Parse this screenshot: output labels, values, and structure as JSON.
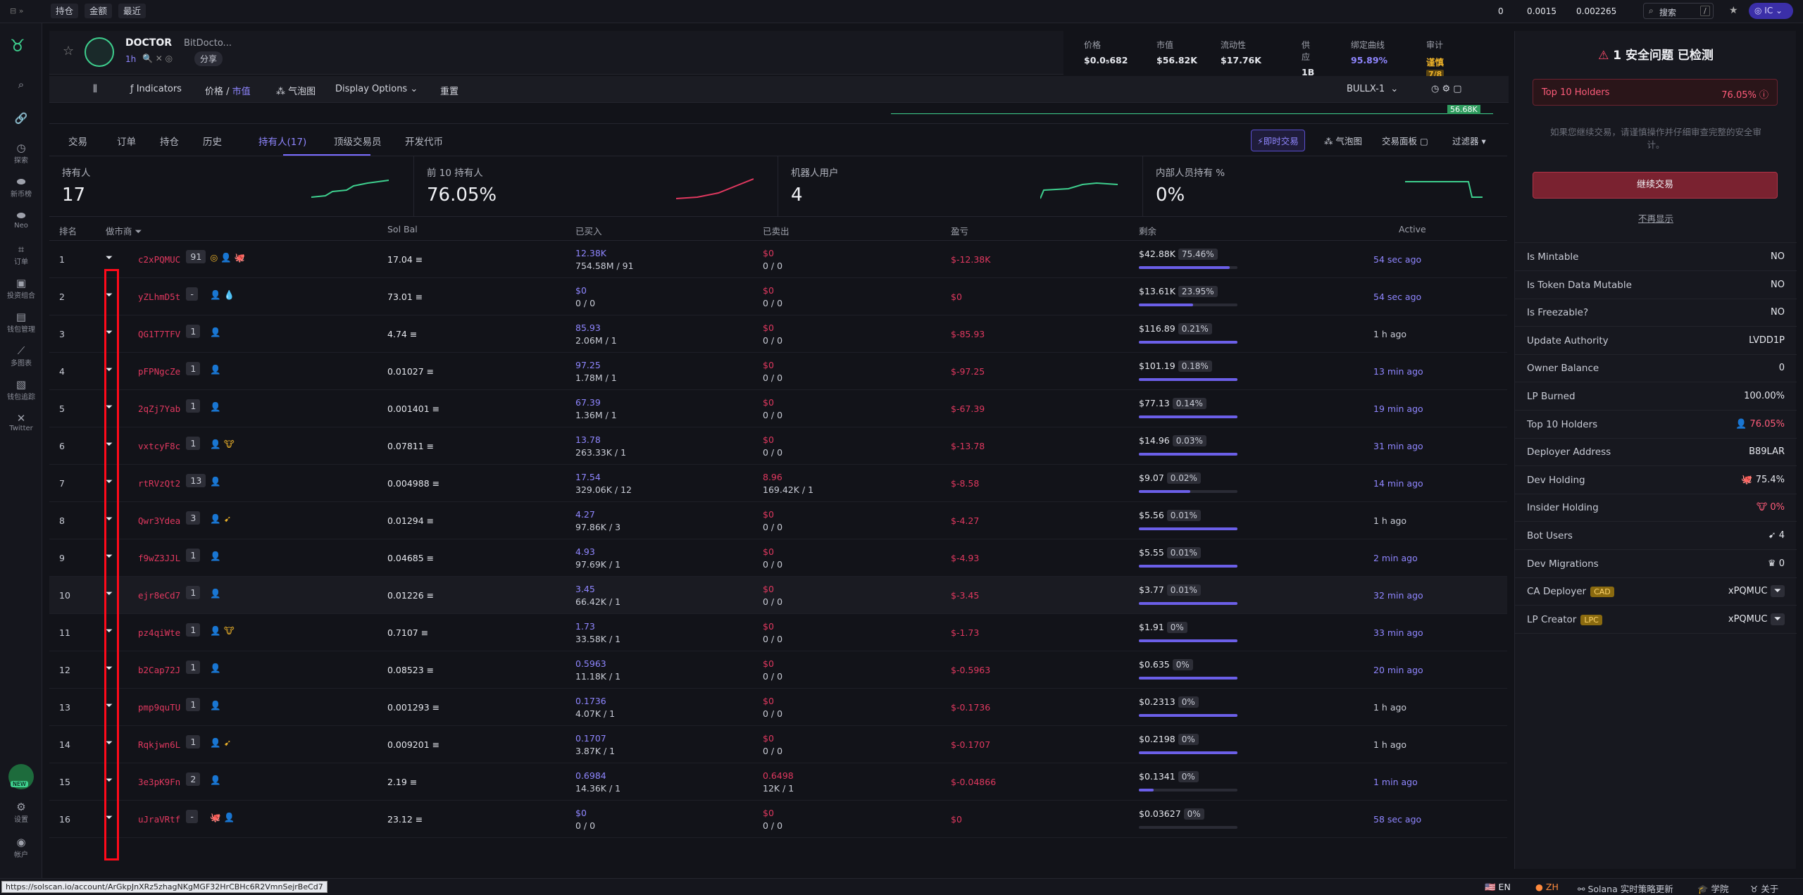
{
  "topbar": {
    "tabs": [
      "持仓",
      "金额",
      "最近"
    ],
    "sol_amount": "0",
    "rate1": "0.0015",
    "rate2": "0.002265",
    "search_placeholder": "搜索",
    "search_key": "/",
    "user": "IC"
  },
  "sidebar": {
    "items": [
      "探索",
      "新币榜",
      "Neo",
      "订单",
      "投资组合",
      "钱包管理",
      "多图表",
      "钱包追踪",
      "Twitter",
      "设置",
      "帐户"
    ],
    "new_badge": "NEW"
  },
  "token": {
    "symbol": "DOCTOR",
    "name": "BitDocto...",
    "age": "1h",
    "share": "分享",
    "stats": [
      {
        "label": "价格",
        "value": "$0.0₅682"
      },
      {
        "label": "市值",
        "value": "$56.82K"
      },
      {
        "label": "流动性",
        "value": "$17.76K"
      },
      {
        "label": "供应",
        "value": "1B"
      },
      {
        "label": "绑定曲线",
        "value": "95.89%"
      },
      {
        "label": "审计",
        "value": "谨慎"
      }
    ],
    "audit_score": "7/8"
  },
  "toolbar": {
    "indicators": "Indicators",
    "price": "价格",
    "mcap": "市值",
    "bubble": "气泡图",
    "display": "Display Options",
    "reset": "重置",
    "bot": "BULLX-1",
    "chart_mcap": "56.68K"
  },
  "tabs": [
    "交易",
    "订单",
    "持仓",
    "历史",
    "持有人(17)",
    "顶级交易员",
    "开发代币"
  ],
  "right_actions": {
    "instant": "即时交易",
    "bubble": "气泡图",
    "panel": "交易面板",
    "filter": "过滤器"
  },
  "summary": [
    {
      "label": "持有人",
      "value": "17"
    },
    {
      "label": "前 10 持有人",
      "value": "76.05%"
    },
    {
      "label": "机器人用户",
      "value": "4"
    },
    {
      "label": "内部人员持有 %",
      "value": "0%"
    }
  ],
  "table": {
    "headers": [
      "排名",
      "做市商",
      "Sol Bal",
      "已买入",
      "已卖出",
      "盈亏",
      "剩余",
      "Active"
    ],
    "rows": [
      {
        "rank": "1",
        "addr": "c2xPQMUC",
        "cnt": "91",
        "sol": "17.04",
        "buy": "12.38K",
        "buy2": "754.58M / 91",
        "sell": "$0",
        "sell2": "0 / 0",
        "pnl": "$-12.38K",
        "rem": "$42.88K",
        "pct": "75.46%",
        "fill": 0.92,
        "active": "54 sec ago",
        "badges": "◎ 👤 🐙"
      },
      {
        "rank": "2",
        "addr": "yZLhmD5t",
        "cnt": "-",
        "sol": "73.01",
        "buy": "$0",
        "buy2": "0 / 0",
        "sell": "$0",
        "sell2": "0 / 0",
        "pnl": "$0",
        "rem": "$13.61K",
        "pct": "23.95%",
        "fill": 0.55,
        "active": "54 sec ago",
        "badges": "👤 💧"
      },
      {
        "rank": "3",
        "addr": "QG1T7TFV",
        "cnt": "1",
        "sol": "4.74",
        "buy": "85.93",
        "buy2": "2.06M / 1",
        "sell": "$0",
        "sell2": "0 / 0",
        "pnl": "$-85.93",
        "rem": "$116.89",
        "pct": "0.21%",
        "fill": 1,
        "active": "1 h ago",
        "badges": "👤"
      },
      {
        "rank": "4",
        "addr": "pFPNgcZe",
        "cnt": "1",
        "sol": "0.01027",
        "buy": "97.25",
        "buy2": "1.78M / 1",
        "sell": "$0",
        "sell2": "0 / 0",
        "pnl": "$-97.25",
        "rem": "$101.19",
        "pct": "0.18%",
        "fill": 1,
        "active": "13 min ago",
        "badges": "👤"
      },
      {
        "rank": "5",
        "addr": "2qZj7Yab",
        "cnt": "1",
        "sol": "0.001401",
        "buy": "67.39",
        "buy2": "1.36M / 1",
        "sell": "$0",
        "sell2": "0 / 0",
        "pnl": "$-67.39",
        "rem": "$77.13",
        "pct": "0.14%",
        "fill": 1,
        "active": "19 min ago",
        "badges": "👤"
      },
      {
        "rank": "6",
        "addr": "vxtcyF8c",
        "cnt": "1",
        "sol": "0.07811",
        "buy": "13.78",
        "buy2": "263.33K / 1",
        "sell": "$0",
        "sell2": "0 / 0",
        "pnl": "$-13.78",
        "rem": "$14.96",
        "pct": "0.03%",
        "fill": 1,
        "active": "31 min ago",
        "badges": "👤 🐮"
      },
      {
        "rank": "7",
        "addr": "rtRVzQt2",
        "cnt": "13",
        "sol": "0.004988",
        "buy": "17.54",
        "buy2": "329.06K / 12",
        "sell": "8.96",
        "sell2": "169.42K / 1",
        "pnl": "$-8.58",
        "rem": "$9.07",
        "pct": "0.02%",
        "fill": 0.52,
        "active": "14 min ago",
        "badges": "👤"
      },
      {
        "rank": "8",
        "addr": "Qwr3Ydea",
        "cnt": "3",
        "sol": "0.01294",
        "buy": "4.27",
        "buy2": "97.86K / 3",
        "sell": "$0",
        "sell2": "0 / 0",
        "pnl": "$-4.27",
        "rem": "$5.56",
        "pct": "0.01%",
        "fill": 1,
        "active": "1 h ago",
        "badges": "👤 ➹"
      },
      {
        "rank": "9",
        "addr": "f9wZ3JJL",
        "cnt": "1",
        "sol": "0.04685",
        "buy": "4.93",
        "buy2": "97.69K / 1",
        "sell": "$0",
        "sell2": "0 / 0",
        "pnl": "$-4.93",
        "rem": "$5.55",
        "pct": "0.01%",
        "fill": 1,
        "active": "2 min ago",
        "badges": "👤"
      },
      {
        "rank": "10",
        "addr": "ejr8eCd7",
        "cnt": "1",
        "sol": "0.01226",
        "buy": "3.45",
        "buy2": "66.42K / 1",
        "sell": "$0",
        "sell2": "0 / 0",
        "pnl": "$-3.45",
        "rem": "$3.77",
        "pct": "0.01%",
        "fill": 1,
        "active": "32 min ago",
        "badges": "👤"
      },
      {
        "rank": "11",
        "addr": "pz4qiWte",
        "cnt": "1",
        "sol": "0.7107",
        "buy": "1.73",
        "buy2": "33.58K / 1",
        "sell": "$0",
        "sell2": "0 / 0",
        "pnl": "$-1.73",
        "rem": "$1.91",
        "pct": "0%",
        "fill": 1,
        "active": "33 min ago",
        "badges": "👤 🐮"
      },
      {
        "rank": "12",
        "addr": "b2Cap72J",
        "cnt": "1",
        "sol": "0.08523",
        "buy": "0.5963",
        "buy2": "11.18K / 1",
        "sell": "$0",
        "sell2": "0 / 0",
        "pnl": "$-0.5963",
        "rem": "$0.635",
        "pct": "0%",
        "fill": 1,
        "active": "20 min ago",
        "badges": "👤"
      },
      {
        "rank": "13",
        "addr": "pmp9quTU",
        "cnt": "1",
        "sol": "0.001293",
        "buy": "0.1736",
        "buy2": "4.07K / 1",
        "sell": "$0",
        "sell2": "0 / 0",
        "pnl": "$-0.1736",
        "rem": "$0.2313",
        "pct": "0%",
        "fill": 1,
        "active": "1 h ago",
        "badges": "👤"
      },
      {
        "rank": "14",
        "addr": "Rqkjwn6L",
        "cnt": "1",
        "sol": "0.009201",
        "buy": "0.1707",
        "buy2": "3.87K / 1",
        "sell": "$0",
        "sell2": "0 / 0",
        "pnl": "$-0.1707",
        "rem": "$0.2198",
        "pct": "0%",
        "fill": 1,
        "active": "1 h ago",
        "badges": "👤 ➹"
      },
      {
        "rank": "15",
        "addr": "3e3pK9Fn",
        "cnt": "2",
        "sol": "2.19",
        "buy": "0.6984",
        "buy2": "14.36K / 1",
        "sell": "0.6498",
        "sell2": "12K / 1",
        "pnl": "$-0.04866",
        "rem": "$0.1341",
        "pct": "0%",
        "fill": 0.15,
        "active": "1 min ago",
        "badges": "👤"
      },
      {
        "rank": "16",
        "addr": "uJraVRtf",
        "cnt": "-",
        "sol": "23.12",
        "buy": "$0",
        "buy2": "0 / 0",
        "sell": "$0",
        "sell2": "0 / 0",
        "pnl": "$0",
        "rem": "$0.03627",
        "pct": "0%",
        "fill": 0,
        "active": "58 sec ago",
        "badges": "🐙 👤"
      }
    ]
  },
  "security": {
    "title": "1 安全问题 已检测",
    "alert_label": "Top 10 Holders",
    "alert_value": "76.05%",
    "desc": "如果您继续交易，请谨慎操作并仔细审查完整的安全审计。",
    "continue": "继续交易",
    "dismiss": "不再显示",
    "checks": [
      {
        "k": "Is Mintable",
        "v": "NO"
      },
      {
        "k": "Is Token Data Mutable",
        "v": "NO"
      },
      {
        "k": "Is Freezable?",
        "v": "NO"
      },
      {
        "k": "Update Authority",
        "v": "LVDD1P"
      },
      {
        "k": "Owner Balance",
        "v": "0"
      },
      {
        "k": "LP Burned",
        "v": "100.00%"
      },
      {
        "k": "Top 10 Holders",
        "v": "76.05%"
      },
      {
        "k": "Deployer Address",
        "v": "B89LAR"
      },
      {
        "k": "Dev Holding",
        "v": "75.4%"
      },
      {
        "k": "Insider Holding",
        "v": "0%"
      },
      {
        "k": "Bot Users",
        "v": "4"
      },
      {
        "k": "Dev Migrations",
        "v": "0"
      },
      {
        "k": "CA Deployer",
        "v": "xPQMUC",
        "tag": "CAD"
      },
      {
        "k": "LP Creator",
        "v": "xPQMUC",
        "tag": "LPC"
      }
    ]
  },
  "bottom": {
    "url": "https://solscan.io/account/ArGkpJnXRz5zhagNKgMGF32HrCBHc6R2VmnSejrBeCd7",
    "lang_en": "EN",
    "lang_zh": "ZH",
    "solana": "Solana 实时策略更新",
    "academy": "学院",
    "about": "关于"
  }
}
